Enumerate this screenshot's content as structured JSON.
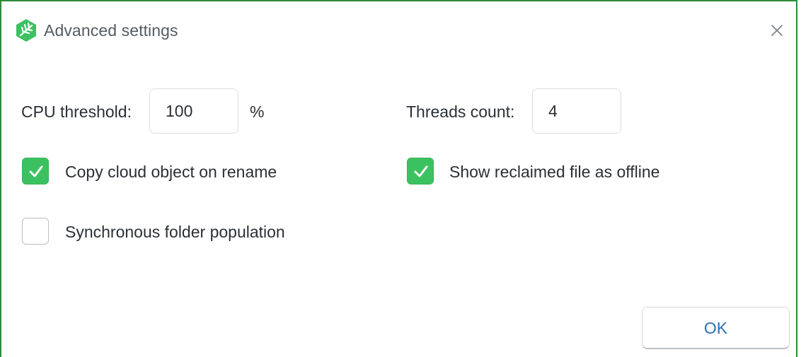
{
  "window": {
    "title": "Advanced settings",
    "app_icon": "leaf-logo-icon",
    "close_icon": "close-icon"
  },
  "cpu_threshold": {
    "label": "CPU threshold:",
    "value": "100",
    "unit": "%"
  },
  "threads_count": {
    "label": "Threads count:",
    "value": "4"
  },
  "options": {
    "copy_cloud_object": {
      "label": "Copy cloud object on rename",
      "checked": true
    },
    "show_reclaimed": {
      "label": "Show reclaimed file as offline",
      "checked": true
    },
    "sync_folder_population": {
      "label": "Synchronous folder population",
      "checked": false
    }
  },
  "buttons": {
    "ok_label": "OK"
  },
  "colors": {
    "accent_green": "#3cc161",
    "window_border": "#2e8b3a",
    "ok_text": "#2f6fb2"
  }
}
